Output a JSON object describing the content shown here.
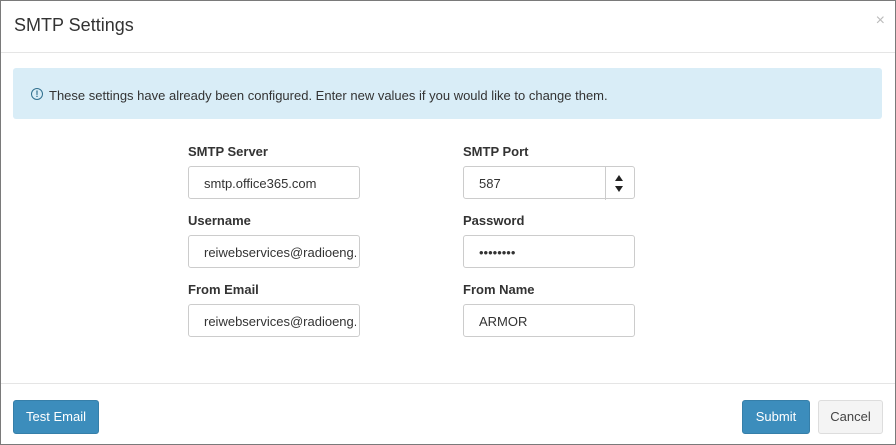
{
  "dialog": {
    "title": "SMTP Settings",
    "close_symbol": "×"
  },
  "alert": {
    "icon": "info-icon",
    "icon_glyph": "!",
    "message": "These settings have already been configured. Enter new values if you would like to change them."
  },
  "form": {
    "smtp_server": {
      "label": "SMTP Server",
      "value": "smtp.office365.com"
    },
    "smtp_port": {
      "label": "SMTP Port",
      "value": "587"
    },
    "username": {
      "label": "Username",
      "value": "reiwebservices@radioeng..."
    },
    "password": {
      "label": "Password",
      "value": "••••••••"
    },
    "from_email": {
      "label": "From Email",
      "value": "reiwebservices@radioeng..."
    },
    "from_name": {
      "label": "From Name",
      "value": "ARMOR"
    }
  },
  "footer": {
    "test_email_label": "Test Email",
    "submit_label": "Submit",
    "cancel_label": "Cancel"
  }
}
